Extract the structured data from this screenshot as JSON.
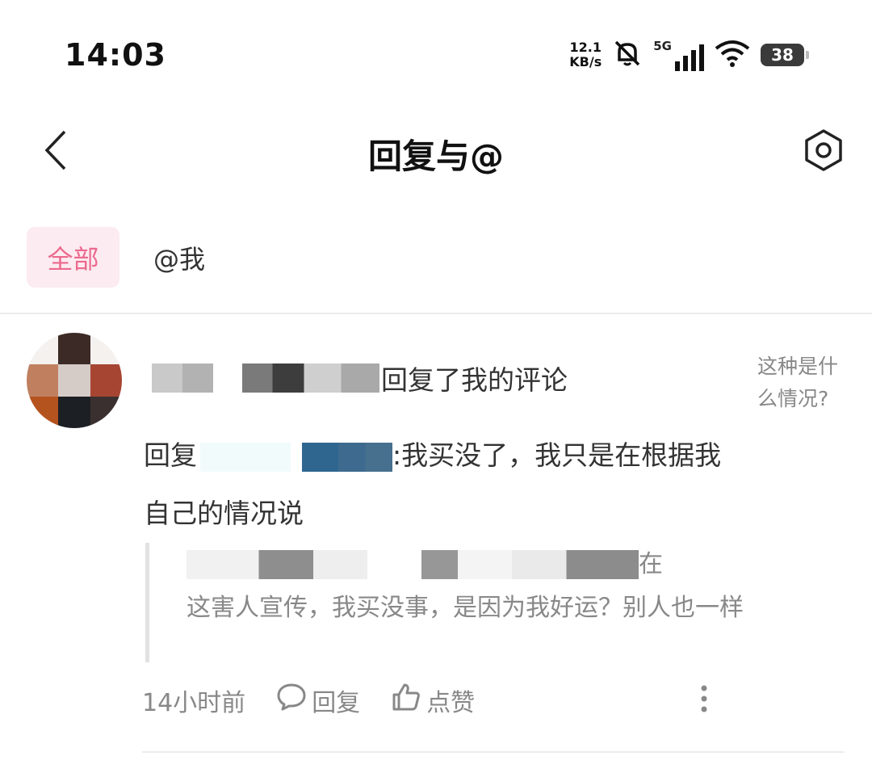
{
  "status_bar": {
    "time": "14:03",
    "net_speed_value": "12.1",
    "net_speed_unit": "KB/s",
    "network_type": "5G",
    "battery": "38",
    "icons": [
      "mute-bell-icon",
      "signal-icon",
      "wifi-icon",
      "battery-icon"
    ]
  },
  "header": {
    "title": "回复与@",
    "back_icon": "chevron-left-icon",
    "settings_icon": "settings-hex-icon"
  },
  "tabs": [
    {
      "label": "全部",
      "active": true
    },
    {
      "label": "@我",
      "active": false
    }
  ],
  "colors": {
    "accent": "#ec6a8e",
    "accent_bg": "#fcebf0",
    "text_primary": "#333333",
    "text_secondary": "#888888"
  },
  "notification": {
    "action_text": "回复了我的评论",
    "side_note": "这种是什么情况?",
    "reply_prefix": "回复",
    "reply_body": ":我买没了，我只是在根据我自己的情况说",
    "quote_tail": "在",
    "quote_body": "这害人宣传，我买没事，是因为我好运？别人也一样",
    "time_ago": "14小时前",
    "reply_label": "回复",
    "like_label": "点赞"
  }
}
